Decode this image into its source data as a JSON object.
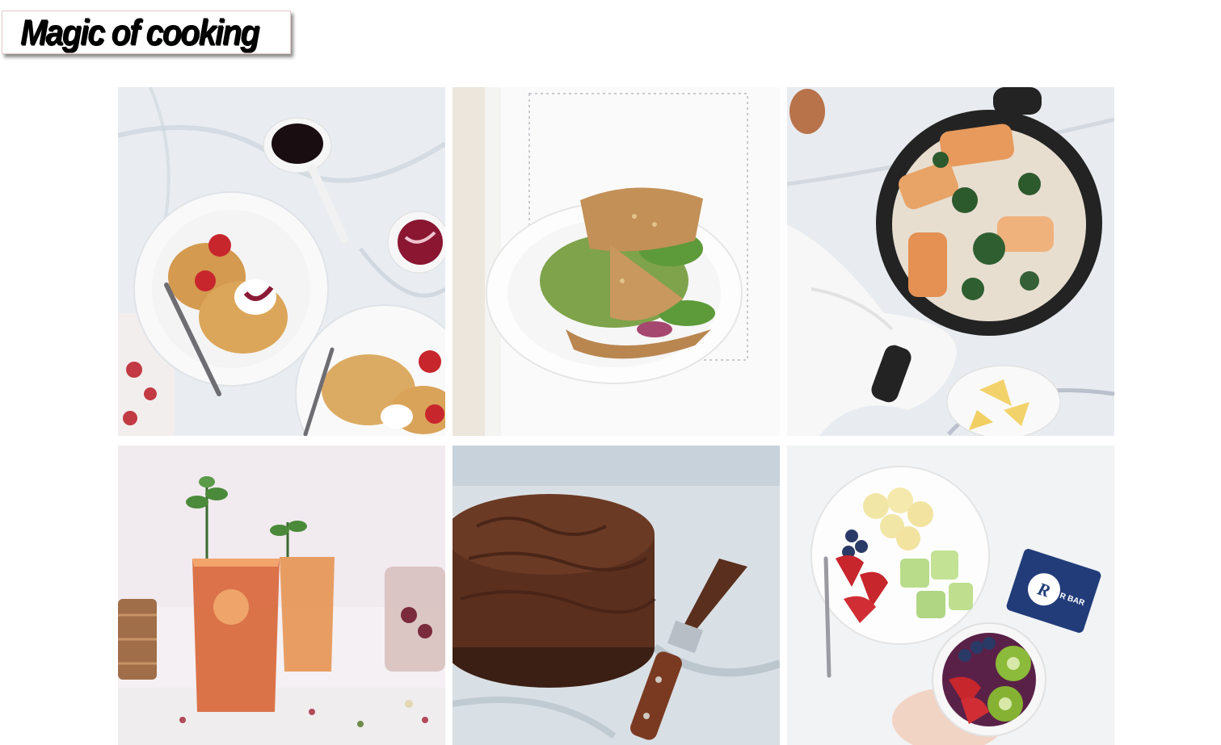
{
  "site": {
    "logo_text": "Magic of cooking"
  },
  "gallery": {
    "items": [
      {
        "name": "pancakes-with-strawberries",
        "icon": "food-photo"
      },
      {
        "name": "arugula-crepe",
        "icon": "food-photo"
      },
      {
        "name": "salmon-skillet",
        "icon": "food-photo"
      },
      {
        "name": "iced-tea-drinks",
        "icon": "food-photo"
      },
      {
        "name": "chocolate-cake",
        "icon": "food-photo"
      },
      {
        "name": "fruit-bowl",
        "icon": "food-photo"
      }
    ],
    "snack_bar_label": "R BAR"
  },
  "colors": {
    "background": "#ffffff",
    "logo_text": "#000000",
    "logo_border": "#e2c9c9"
  }
}
